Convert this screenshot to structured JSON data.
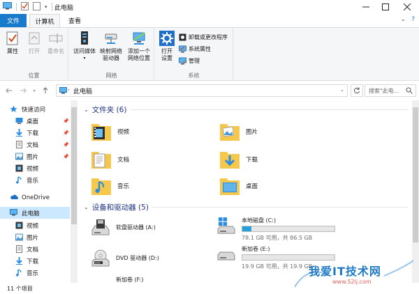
{
  "window": {
    "title": "此电脑",
    "controls": [
      "minimize",
      "maximize",
      "close"
    ]
  },
  "ribbon_tabs": {
    "file": "文件",
    "computer": "计算机",
    "view": "查看"
  },
  "ribbon": {
    "location_group": {
      "label": "位置",
      "properties": "属性",
      "open": "打开",
      "rename": "重命名"
    },
    "network_group": {
      "label": "网络",
      "access_media": "访问媒体",
      "map_drive_line1": "映射网络",
      "map_drive_line2": "驱动器",
      "add_location_line1": "添加一个",
      "add_location_line2": "网络位置"
    },
    "system_group": {
      "label": "系统",
      "open_settings_line1": "打开",
      "open_settings_line2": "设置",
      "uninstall": "卸载或更改程序",
      "system_properties": "系统属性",
      "manage": "管理"
    }
  },
  "address": {
    "path": "此电脑",
    "search_placeholder": "搜索\"此电..."
  },
  "nav_pane": {
    "quick_access": "快速访问",
    "quick_items": [
      "桌面",
      "下载",
      "文档",
      "图片",
      "视频",
      "音乐"
    ],
    "onedrive": "OneDrive",
    "this_pc": "此电脑",
    "pc_items": [
      "视频",
      "图片",
      "文档",
      "下载",
      "音乐"
    ]
  },
  "content": {
    "folders_header": "文件夹 (6)",
    "folders": [
      "视频",
      "图片",
      "文档",
      "下载",
      "音乐",
      "桌面"
    ],
    "devices_header": "设备和驱动器 (5)",
    "drives": [
      {
        "name": "软盘驱动器 (A:)"
      },
      {
        "name": "本地磁盘 (C:)",
        "free": "78.1 GB 可用，共 86.5 GB",
        "used_fraction": 0.097
      },
      {
        "name": "DVD 驱动器 (D:)"
      },
      {
        "name": "新加卷 (E:)",
        "free": "19.9 GB 可用，共 19.9 GB",
        "used_fraction": 0.0
      },
      {
        "name": "新加卷 (F:)"
      }
    ]
  },
  "status": {
    "item_count": "11 个项目"
  },
  "watermark": {
    "text": "我爱IT技术网",
    "url": "www.52ij.com"
  },
  "colors": {
    "file_tab": "#1979ca",
    "section_header": "#1e3287",
    "drive_bar": "#26a0da",
    "selected": "#cce8ff",
    "folder": "#f5c84c"
  }
}
